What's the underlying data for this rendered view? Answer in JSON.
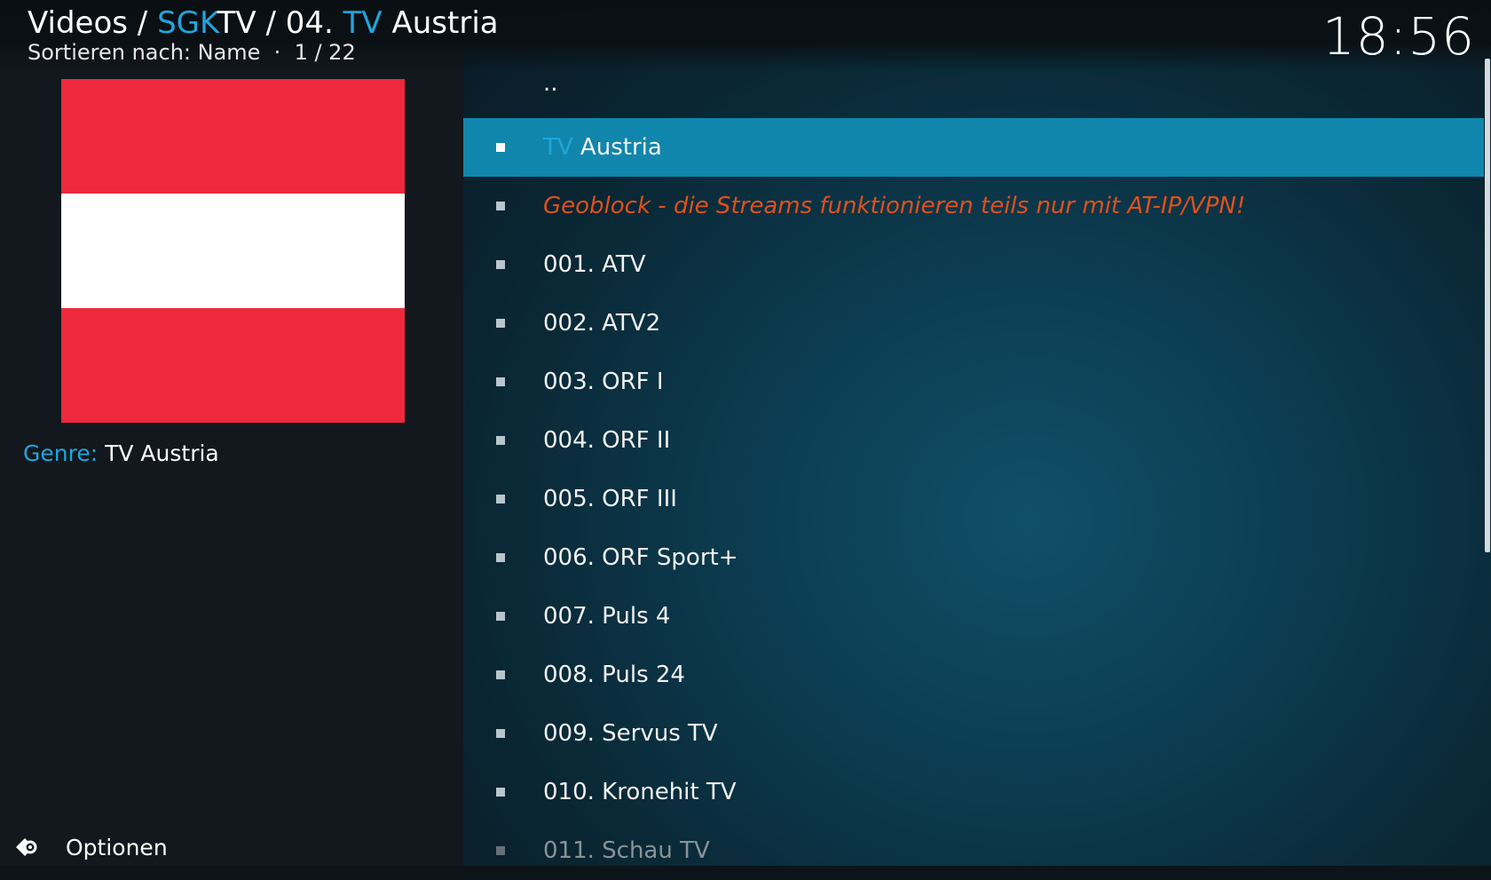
{
  "header": {
    "crumb_videos": "Videos",
    "crumb_sep1": " / ",
    "crumb_sgk": "SGK",
    "crumb_tv": "TV",
    "crumb_sep2": " / ",
    "crumb_04": "04. ",
    "crumb_tv2": "TV",
    "crumb_austria": " Austria",
    "sort_line": "Sortieren nach: Name  ·  1 / 22",
    "clock": "18:56"
  },
  "info": {
    "genre_label": "Genre:",
    "genre_value": "TV Austria",
    "flag_colors": [
      "#ee293d",
      "#ffffff",
      "#ee293d"
    ]
  },
  "footer": {
    "options_label": "Optionen",
    "options_icon": "gear-icon"
  },
  "list": {
    "parent": "..",
    "selected_prefix": "TV",
    "selected_rest": " Austria",
    "items": [
      "Geoblock - die Streams funktionieren teils nur mit AT-IP/VPN!",
      "001. ATV",
      "002. ATV2",
      "003. ORF I",
      "004. ORF II",
      "005. ORF III",
      "006. ORF Sport+",
      "007. Puls 4",
      "008. Puls 24",
      "009. Servus TV",
      "010. Kronehit TV",
      "011. Schau TV"
    ]
  },
  "colors": {
    "accent": "#1fa5dc",
    "selected_row": "#1186ad",
    "warning": "#e0501c"
  }
}
